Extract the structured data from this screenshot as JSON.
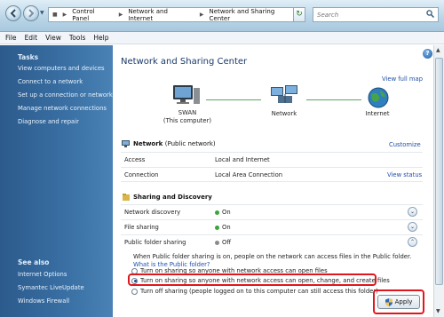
{
  "address_bar": {
    "breadcrumbs": [
      "Control Panel",
      "Network and Internet",
      "Network and Sharing Center"
    ],
    "search_placeholder": "Search"
  },
  "menu": [
    "File",
    "Edit",
    "View",
    "Tools",
    "Help"
  ],
  "sidebar": {
    "tasks_title": "Tasks",
    "tasks": [
      "View computers and devices",
      "Connect to a network",
      "Set up a connection or network",
      "Manage network connections",
      "Diagnose and repair"
    ],
    "see_also_title": "See also",
    "see_also": [
      "Internet Options",
      "Symantec LiveUpdate",
      "Windows Firewall"
    ]
  },
  "main": {
    "title": "Network and Sharing Center",
    "view_full_map": "View full map",
    "map": {
      "computer_name": "SWAN",
      "computer_sub": "(This computer)",
      "network": "Network",
      "internet": "Internet"
    },
    "network": {
      "name": "Network",
      "type": "(Public network)",
      "customize": "Customize",
      "rows": [
        {
          "label": "Access",
          "value": "Local and Internet",
          "action": ""
        },
        {
          "label": "Connection",
          "value": "Local Area Connection",
          "action": "View status"
        }
      ]
    },
    "sharing": {
      "title": "Sharing and Discovery",
      "rows": [
        {
          "label": "Network discovery",
          "status": "On",
          "color": "#3aa53a",
          "chevron": "⌄"
        },
        {
          "label": "File sharing",
          "status": "On",
          "color": "#3aa53a",
          "chevron": "⌄"
        },
        {
          "label": "Public folder sharing",
          "status": "Off",
          "color": "#8a8a8a",
          "chevron": "⌃"
        }
      ],
      "description": "When Public folder sharing is on, people on the network can access files in the Public folder.",
      "what_is_link": "What is the Public folder?",
      "options": [
        {
          "label": "Turn on sharing so anyone with network access can open files",
          "selected": false
        },
        {
          "label": "Turn on sharing so anyone with network access can open, change, and create files",
          "selected": true
        },
        {
          "label": "Turn off sharing (people logged on to this computer can still access this folder)",
          "selected": false
        }
      ],
      "apply_label": "Apply"
    }
  }
}
